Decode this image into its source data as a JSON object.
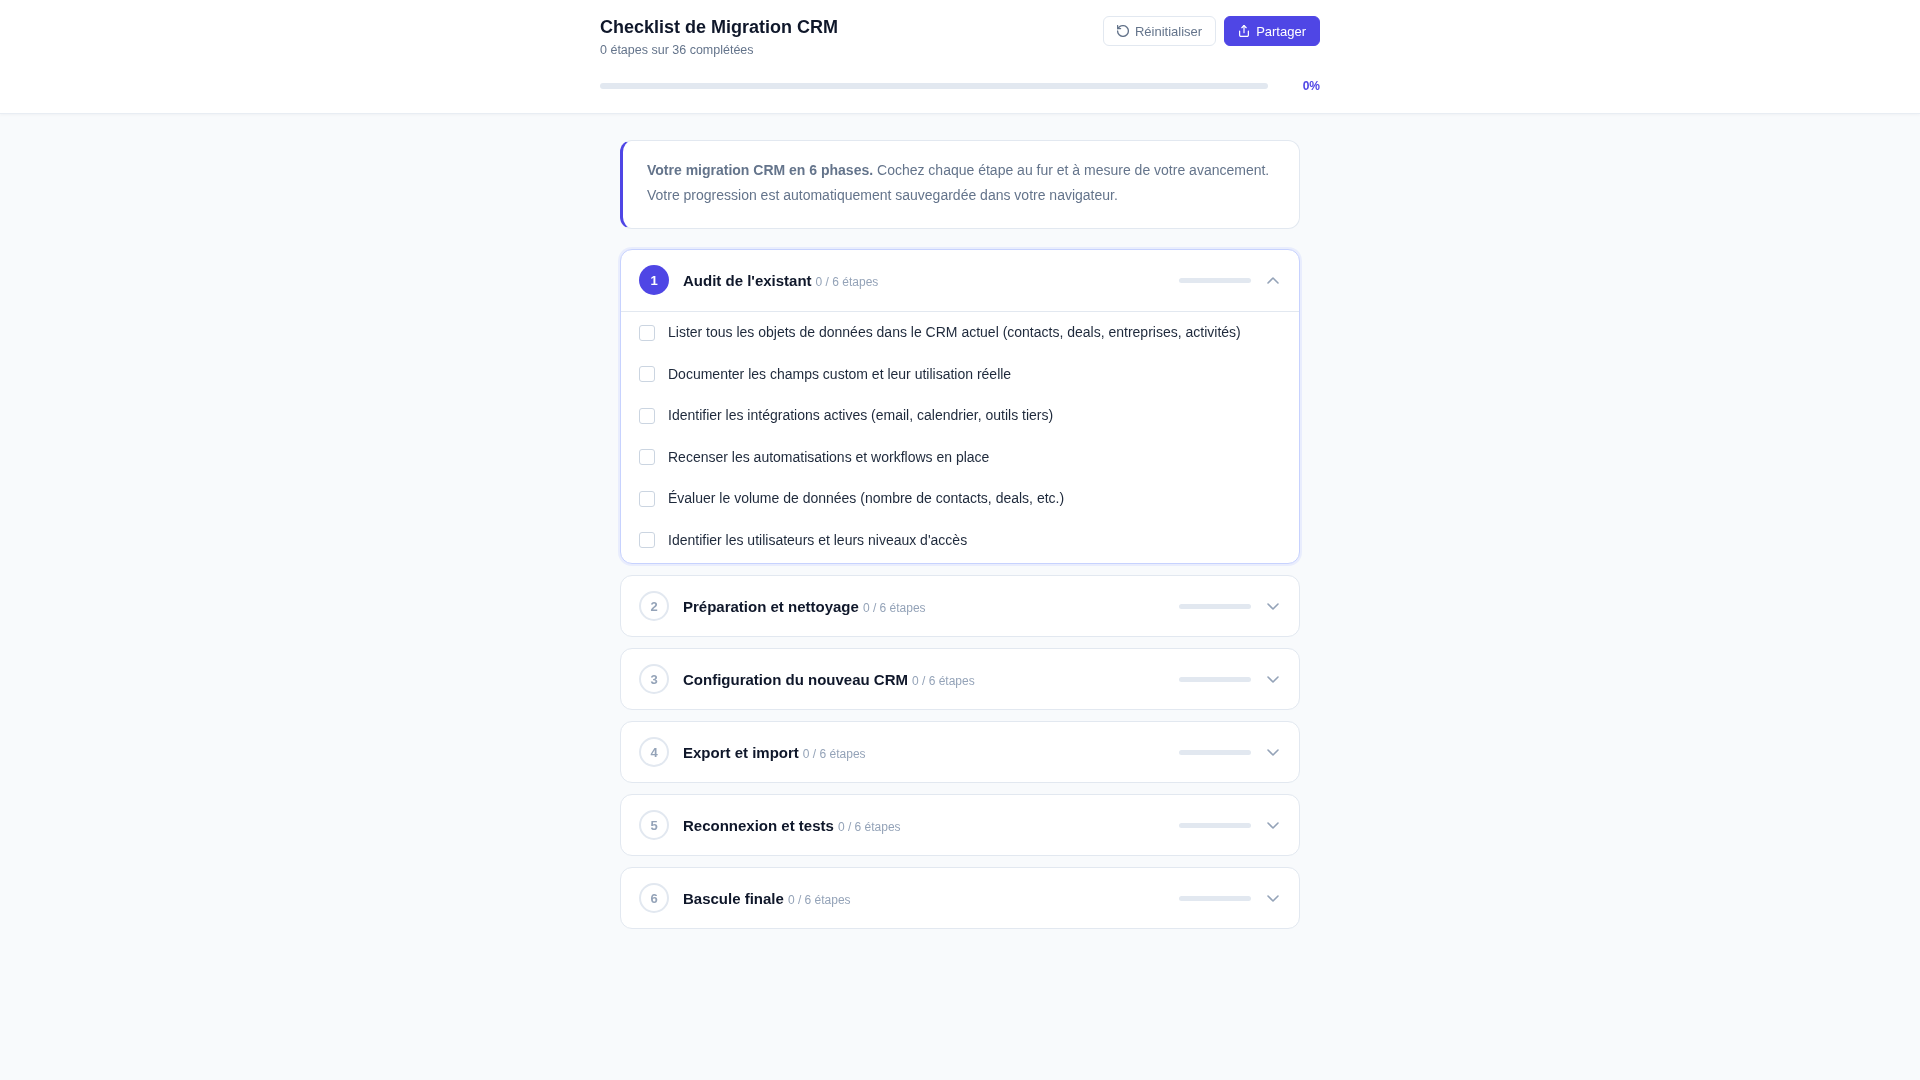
{
  "header": {
    "title": "Checklist de Migration CRM",
    "subtitle": "0 étapes sur 36 complétées",
    "buttons": [
      {
        "kind": "secondary",
        "label": "Réinitialiser"
      },
      {
        "kind": "primary",
        "label": "Partager"
      }
    ],
    "progress": {
      "level": 0,
      "reading": "0%"
    }
  },
  "intro": {
    "text": "**Votre migration CRM en 6 phases.** Cochez chaque étape au fur et à mesure de votre avancement. Votre progression est automatiquement sauvegardée dans votre navigateur."
  },
  "phases": [
    {
      "number": "1",
      "title": "Audit de l'existant",
      "count": "0 / 6 étapes",
      "level": 0,
      "expanded": true,
      "steps": [
        {
          "label": "Lister tous les objets de données dans le CRM actuel (contacts, deals, entreprises, activités)",
          "checked": false
        },
        {
          "label": "Documenter les champs custom et leur utilisation réelle",
          "checked": false
        },
        {
          "label": "Identifier les intégrations actives (email, calendrier, outils tiers)",
          "checked": false
        },
        {
          "label": "Recenser les automatisations et workflows en place",
          "checked": false
        },
        {
          "label": "Évaluer le volume de données (nombre de contacts, deals, etc.)",
          "checked": false
        },
        {
          "label": "Identifier les utilisateurs et leurs niveaux d'accès",
          "checked": false
        }
      ]
    },
    {
      "number": "2",
      "title": "Préparation et nettoyage",
      "count": "0 / 6 étapes",
      "level": 0,
      "expanded": false
    },
    {
      "number": "3",
      "title": "Configuration du nouveau CRM",
      "count": "0 / 6 étapes",
      "level": 0,
      "expanded": false
    },
    {
      "number": "4",
      "title": "Export et import",
      "count": "0 / 6 étapes",
      "level": 0,
      "expanded": false
    },
    {
      "number": "5",
      "title": "Reconnexion et tests",
      "count": "0 / 6 étapes",
      "level": 0,
      "expanded": false
    },
    {
      "number": "6",
      "title": "Bascule finale",
      "count": "0 / 6 étapes",
      "level": 0,
      "expanded": false
    }
  ]
}
